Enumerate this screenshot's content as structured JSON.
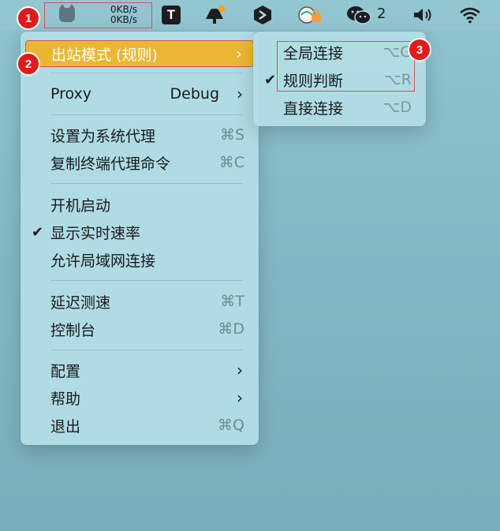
{
  "menubar": {
    "clash": {
      "upload_speed": "0KB/s",
      "download_speed": "0KB/s"
    },
    "t_icon_letter": "T",
    "wechat_count": "2",
    "icons": [
      "clash-cat-icon",
      "t-app-icon",
      "notification-bell-icon",
      "v2-app-icon",
      "vpn-lock-icon",
      "wechat-icon",
      "volume-icon",
      "wifi-icon"
    ]
  },
  "badges": [
    "1",
    "2",
    "3"
  ],
  "main_menu": {
    "outbound_mode": "出站模式 (规则)",
    "proxy": {
      "label": "Proxy",
      "value": "Debug"
    },
    "set_system_proxy": {
      "label": "设置为系统代理",
      "shortcut": "⌘S"
    },
    "copy_terminal_proxy": {
      "label": "复制终端代理命令",
      "shortcut": "⌘C"
    },
    "launch_at_login": "开机启动",
    "show_speed": "显示实时速率",
    "allow_lan": "允许局域网连接",
    "latency_test": {
      "label": "延迟测速",
      "shortcut": "⌘T"
    },
    "dashboard": {
      "label": "控制台",
      "shortcut": "⌘D"
    },
    "config": "配置",
    "help": "帮助",
    "quit": {
      "label": "退出",
      "shortcut": "⌘Q"
    }
  },
  "sub_menu": {
    "global": {
      "label": "全局连接",
      "shortcut": "⌥G"
    },
    "rule": {
      "label": "规则判断",
      "shortcut": "⌥R"
    },
    "direct": {
      "label": "直接连接",
      "shortcut": "⌥D"
    }
  },
  "colors": {
    "highlight": "#ebb733",
    "annotation_red": "#e01b1b",
    "menu_bg": "#b1dde5"
  }
}
